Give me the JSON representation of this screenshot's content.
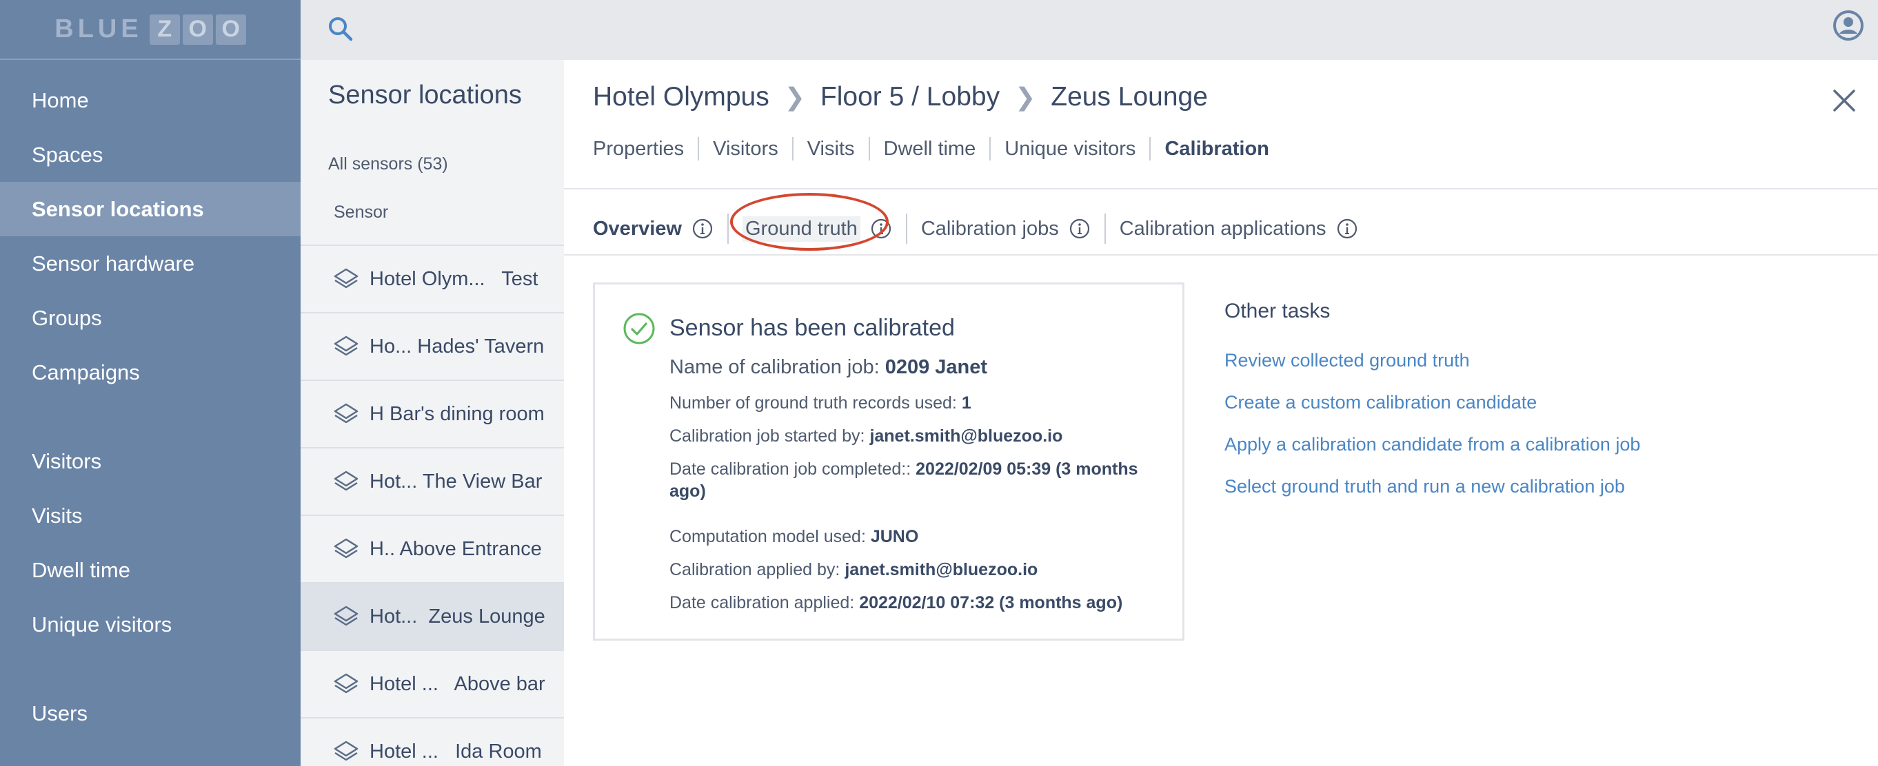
{
  "app": {
    "logo_text": "BLUE",
    "logo_letters": [
      "Z",
      "O",
      "O"
    ]
  },
  "sidebar": {
    "items": [
      {
        "label": "Home"
      },
      {
        "label": "Spaces"
      },
      {
        "label": "Sensor locations",
        "active": true
      },
      {
        "label": "Sensor hardware"
      },
      {
        "label": "Groups"
      },
      {
        "label": "Campaigns"
      },
      {
        "label": "Visitors"
      },
      {
        "label": "Visits"
      },
      {
        "label": "Dwell time"
      },
      {
        "label": "Unique visitors"
      },
      {
        "label": "Users"
      }
    ]
  },
  "topbar": {
    "search_icon": "search-icon",
    "user_icon": "user-icon"
  },
  "sensor_list": {
    "title": "Sensor locations",
    "count_label": "All sensors (53)",
    "column_header": "Sensor",
    "rows": [
      {
        "label": "Hotel Olym...   Test"
      },
      {
        "label": "Ho... Hades' Tavern"
      },
      {
        "label": "H Bar's dining room"
      },
      {
        "label": "Hot... The View Bar"
      },
      {
        "label": "H.. Above Entrance"
      },
      {
        "label": "Hot...  Zeus Lounge",
        "selected": true
      },
      {
        "label": "Hotel ...   Above bar"
      },
      {
        "label": "Hotel ...   Ida Room"
      }
    ]
  },
  "detail": {
    "breadcrumb": [
      "Hotel Olympus",
      "Floor 5 / Lobby",
      "Zeus Lounge"
    ],
    "breadcrumb_separator": "❯",
    "tabs": [
      {
        "label": "Properties"
      },
      {
        "label": "Visitors"
      },
      {
        "label": "Visits"
      },
      {
        "label": "Dwell time"
      },
      {
        "label": "Unique visitors"
      },
      {
        "label": "Calibration",
        "active": true
      }
    ],
    "subtabs": [
      {
        "label": "Overview",
        "active": true
      },
      {
        "label": "Ground truth"
      },
      {
        "label": "Calibration jobs"
      },
      {
        "label": "Calibration applications"
      }
    ],
    "status_card": {
      "title": "Sensor has been calibrated",
      "job_name_label": "Name of calibration job:",
      "job_name_value": "0209 Janet",
      "records_label": "Number of ground truth records used:",
      "records_value": "1",
      "started_by_label": "Calibration job started by:",
      "started_by_value": "janet.smith@bluezoo.io",
      "completed_label": "Date calibration job completed::",
      "completed_value": "2022/02/09 05:39 (3 months ago)",
      "model_label": "Computation model used:",
      "model_value": "JUNO",
      "applied_by_label": "Calibration applied by:",
      "applied_by_value": "janet.smith@bluezoo.io",
      "applied_date_label": "Date calibration applied:",
      "applied_date_value": "2022/02/10 07:32 (3 months ago)"
    },
    "other_tasks": {
      "title": "Other tasks",
      "links": [
        {
          "label": "Review collected ground truth"
        },
        {
          "label": "Create a custom calibration candidate"
        },
        {
          "label": "Apply a calibration candidate from a calibration job"
        },
        {
          "label": "Select ground truth and run a new calibration job"
        }
      ]
    }
  },
  "colors": {
    "sidebar_bg": "#6a84a6",
    "sidebar_active": "#8399b6",
    "link": "#4a86c5",
    "success": "#5cb85c",
    "annotation": "#d4472f"
  }
}
